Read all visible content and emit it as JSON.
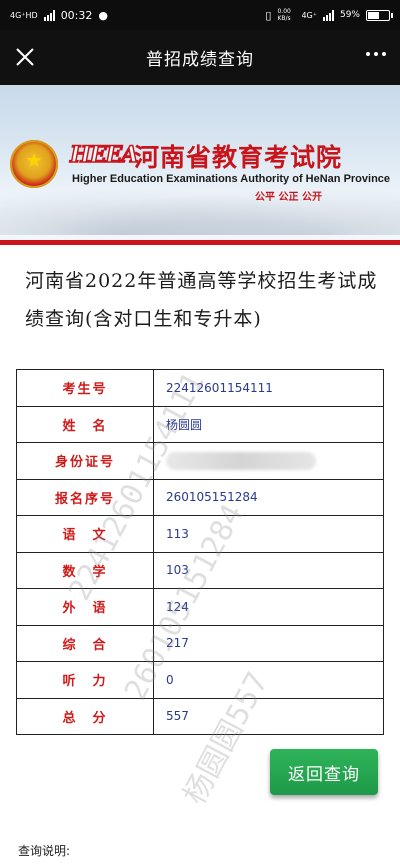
{
  "status_bar": {
    "network": "4G⁺HD",
    "time": "00:32",
    "speed": "0.00 KB/s",
    "network_right": "4G⁺",
    "battery": "59%",
    "battery_level": 0.59
  },
  "nav": {
    "title": "普招成绩查询"
  },
  "banner": {
    "logo_text": "HEEA",
    "org_cn": "河南省教育考试院",
    "org_en": "Higher Education Examinations Authority of HeNan Province",
    "slogan": "公平 公正 公开"
  },
  "heading": "河南省2022年普通高等学校招生考试成绩查询(含对口生和专升本)",
  "table": {
    "rows": [
      {
        "label": "考生号",
        "value": "22412601154111"
      },
      {
        "label": "姓　名",
        "value": "杨圆圆"
      },
      {
        "label": "身份证号",
        "value": ""
      },
      {
        "label": "报名序号",
        "value": "260105151284"
      },
      {
        "label": "语　文",
        "value": "113"
      },
      {
        "label": "数　学",
        "value": "103"
      },
      {
        "label": "外　语",
        "value": "124"
      },
      {
        "label": "综　合",
        "value": "217"
      },
      {
        "label": "听　力",
        "value": "0"
      },
      {
        "label": "总　分",
        "value": "557"
      }
    ]
  },
  "watermark": {
    "line1": "22412601154111",
    "line2": "260105151284",
    "line3": "杨圆圆557"
  },
  "back_button": "返回查询",
  "notes_label": "查询说明:"
}
